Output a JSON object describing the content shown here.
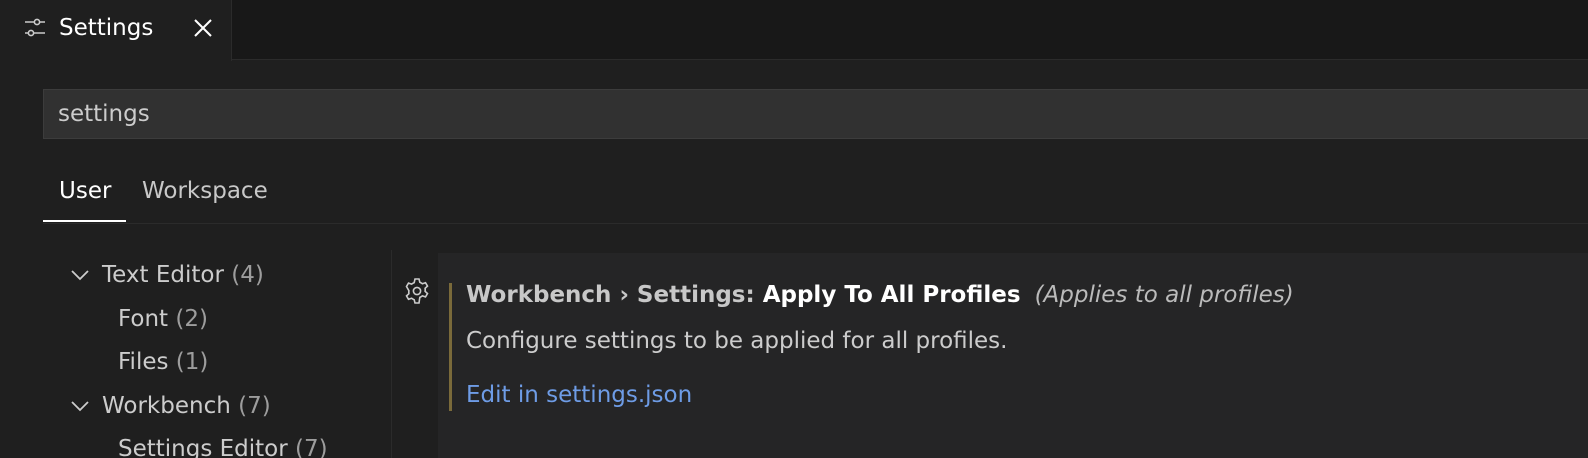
{
  "tab": {
    "title": "Settings",
    "icon": "settings-sliders-icon",
    "close_icon": "close-icon"
  },
  "search": {
    "value": "settings"
  },
  "scopes": {
    "user": "User",
    "workspace": "Workspace",
    "active": "User"
  },
  "toc": [
    {
      "label": "Text Editor",
      "count": "(4)",
      "expanded": true,
      "level": 0
    },
    {
      "label": "Font",
      "count": "(2)",
      "level": 1
    },
    {
      "label": "Files",
      "count": "(1)",
      "level": 1
    },
    {
      "label": "Workbench",
      "count": "(7)",
      "expanded": true,
      "level": 0
    },
    {
      "label": "Settings Editor",
      "count": "(7)",
      "level": 1
    }
  ],
  "setting": {
    "category": "Workbench › Settings: ",
    "label": "Apply To All Profiles",
    "scope_note": "(Applies to all profiles)",
    "description": "Configure settings to be applied for all profiles.",
    "link": "Edit in settings.json",
    "gear_icon": "gear-icon"
  },
  "colors": {
    "background": "#1f1f1f",
    "link": "#6e9ce6",
    "modified_indicator": "#7a6a3a"
  }
}
